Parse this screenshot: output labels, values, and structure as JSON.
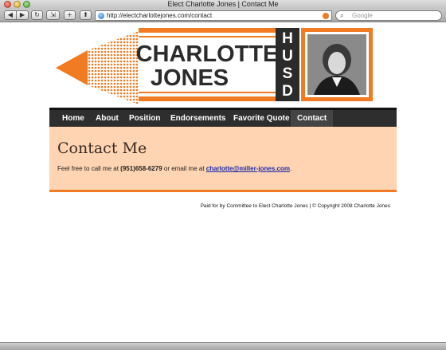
{
  "browser": {
    "window_title": "Elect Charlotte Jones | Contact Me",
    "url": "http://electcharlottejones.com/contact",
    "search_placeholder": "Google",
    "buttons": {
      "back": "◀",
      "forward": "▶",
      "reload": "↻",
      "snapback": "⇲",
      "add_bookmark": "+",
      "share": "⬆"
    },
    "search_icon": "magnifier-icon"
  },
  "header": {
    "name_line1": "CHARLOTTE",
    "name_line2": "JONES",
    "district_letters": [
      "H",
      "U",
      "S",
      "D"
    ],
    "colors": {
      "orange": "#f07b22",
      "dark": "#2b2b2b"
    }
  },
  "nav": {
    "items": [
      {
        "label": "Home"
      },
      {
        "label": "About"
      },
      {
        "label": "Position"
      },
      {
        "label": "Endorsements"
      },
      {
        "label": "Favorite Quote"
      },
      {
        "label": "Contact"
      }
    ],
    "active": "Contact"
  },
  "content": {
    "title": "Contact Me",
    "text_before_phone": "Feel free to call me at ",
    "phone": "(951)658-6279",
    "text_between": " or email me at ",
    "email": "charlotte@miller-jones.com",
    "text_after": "."
  },
  "footer": {
    "text": "Paid for by Committee to Elect Charlotte Jones | © Copyright 2008 Charlotte Jones"
  }
}
